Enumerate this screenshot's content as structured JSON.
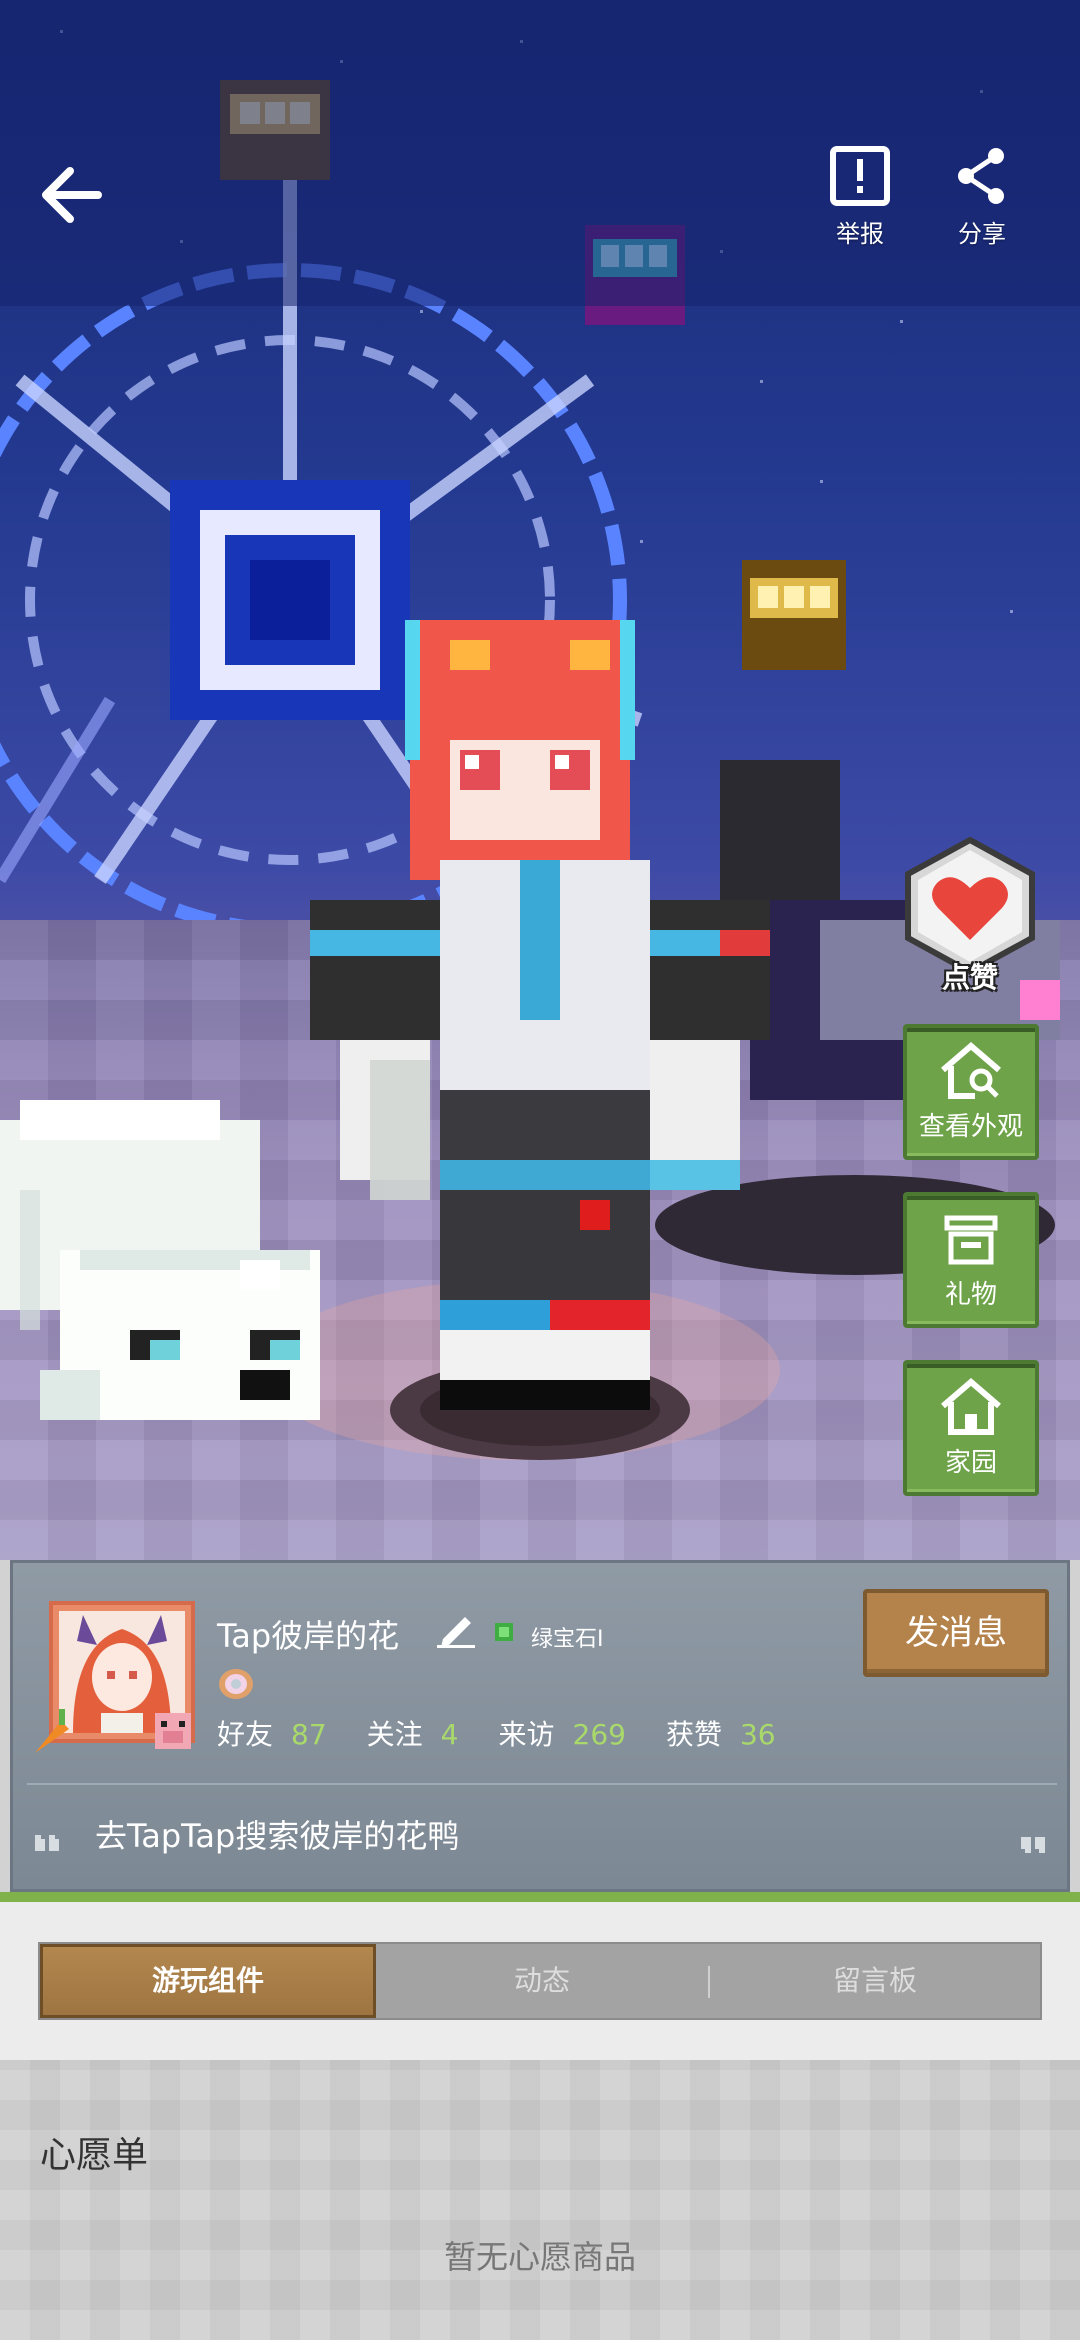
{
  "header": {
    "back_icon": "arrow-left-icon",
    "report_label": "举报",
    "share_label": "分享"
  },
  "actions": {
    "like_label": "点赞",
    "appearance_label": "查看外观",
    "gift_label": "礼物",
    "home_label": "家园"
  },
  "profile": {
    "username": "Tap彼岸的花",
    "rank": "绿宝石I",
    "send_message_label": "发消息",
    "stats": [
      {
        "label": "好友",
        "value": "87"
      },
      {
        "label": "关注",
        "value": "4"
      },
      {
        "label": "来访",
        "value": "269"
      },
      {
        "label": "获赞",
        "value": "36"
      }
    ],
    "signature": "去TapTap搜索彼岸的花鸭"
  },
  "tabs": [
    {
      "label": "游玩组件",
      "active": true
    },
    {
      "label": "动态",
      "active": false
    },
    {
      "label": "留言板",
      "active": false
    }
  ],
  "wishlist": {
    "title": "心愿单",
    "empty_text": "暂无心愿商品"
  },
  "colors": {
    "accent_green": "#6fa34a",
    "stat_value": "#a9d96a",
    "button_brown": "#b4834c"
  }
}
